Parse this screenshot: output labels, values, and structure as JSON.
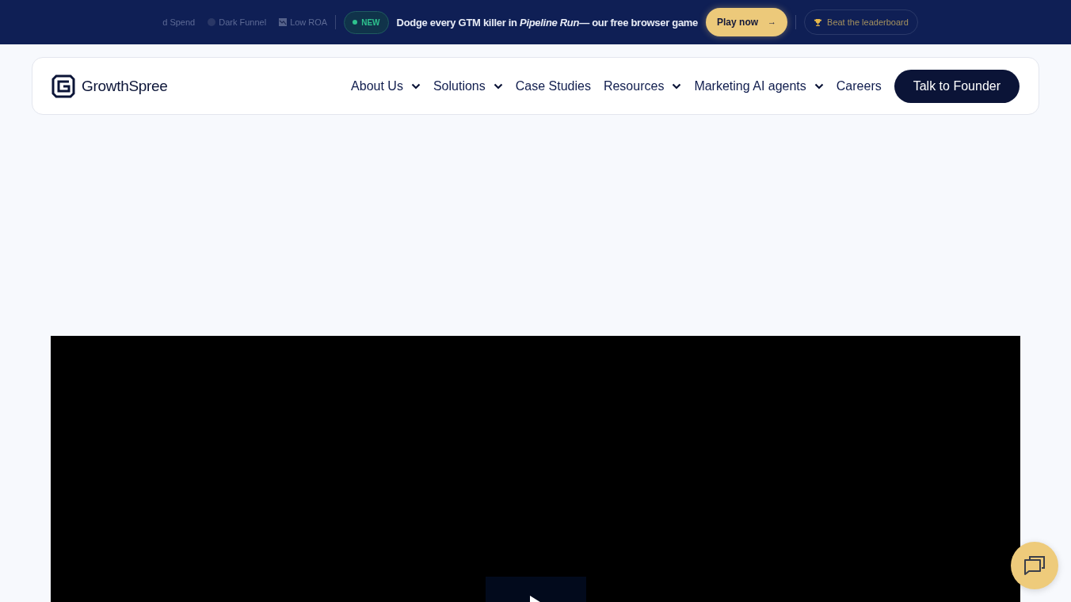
{
  "announcement_bar": {
    "ticker": [
      {
        "label": "d Spend",
        "kind": "plain"
      },
      {
        "label": "Dark Funnel",
        "kind": "dot"
      },
      {
        "label": "Low ROA",
        "kind": "chart"
      }
    ],
    "badge": "NEW",
    "message": "Dodge every GTM killer in *Pipeline Run*— our free browser game",
    "play_button": "Play now",
    "play_arrow": "→",
    "leaderboard_link": "Beat the leaderboard"
  },
  "header": {
    "logo": "GrowthSpree",
    "nav": [
      {
        "label": "About Us",
        "dropdown": true
      },
      {
        "label": "Solutions",
        "dropdown": true
      },
      {
        "label": "Case Studies",
        "dropdown": false
      },
      {
        "label": "Resources",
        "dropdown": true
      },
      {
        "label": "Marketing AI agents",
        "dropdown": true
      },
      {
        "label": "Careers",
        "dropdown": false
      }
    ],
    "cta": "Talk to Founder"
  }
}
